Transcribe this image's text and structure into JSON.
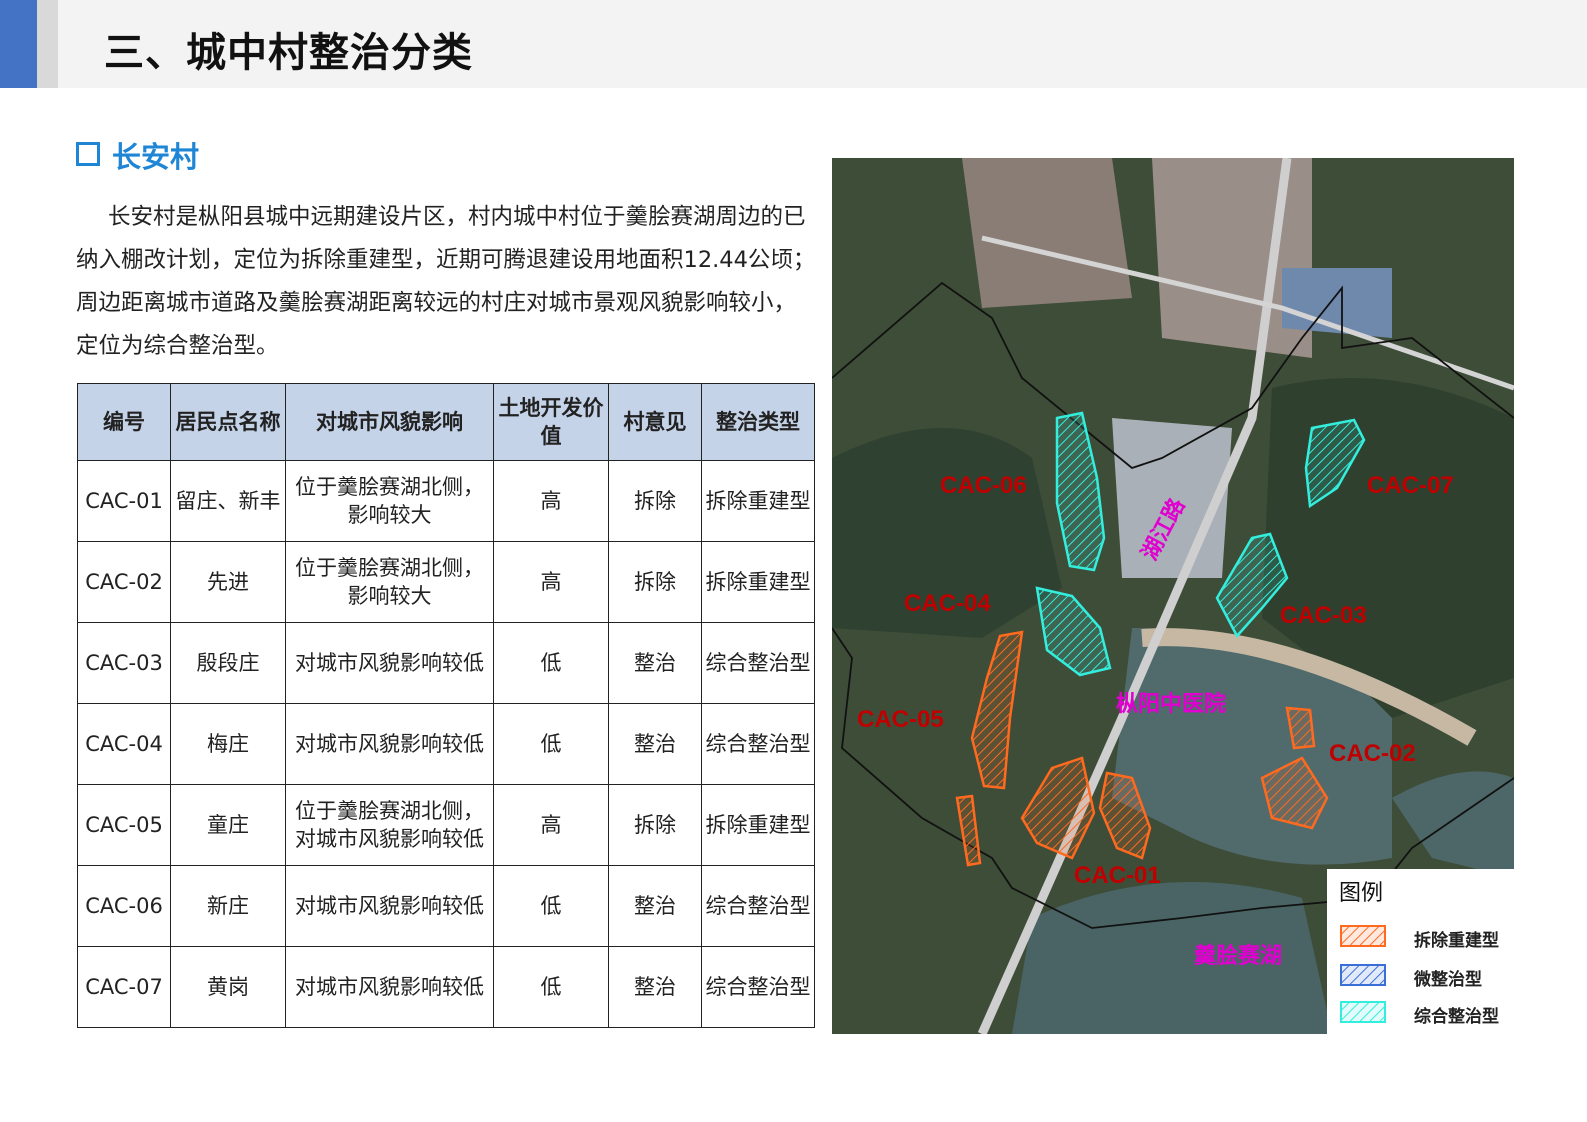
{
  "header": {
    "title": "三、城中村整治分类"
  },
  "section": {
    "title": "长安村"
  },
  "paragraph": "长安村是枞阳县城中远期建设片区，村内城中村位于羹脍赛湖周边的已纳入棚改计划，定位为拆除重建型，近期可腾退建设用地面积12.44公顷；周边距离城市道路及羹脍赛湖距离较远的村庄对城市景观风貌影响较小，定位为综合整治型。",
  "table": {
    "headers": [
      "编号",
      "居民点名称",
      "对城市风貌影响",
      "土地开发价值",
      "村意见",
      "整治类型"
    ],
    "rows": [
      [
        "CAC-01",
        "留庄、新丰",
        "位于羹脍赛湖北侧，影响较大",
        "高",
        "拆除",
        "拆除重建型"
      ],
      [
        "CAC-02",
        "先进",
        "位于羹脍赛湖北侧，影响较大",
        "高",
        "拆除",
        "拆除重建型"
      ],
      [
        "CAC-03",
        "殷段庄",
        "对城市风貌影响较低",
        "低",
        "整治",
        "综合整治型"
      ],
      [
        "CAC-04",
        "梅庄",
        "对城市风貌影响较低",
        "低",
        "整治",
        "综合整治型"
      ],
      [
        "CAC-05",
        "童庄",
        "位于羹脍赛湖北侧，对城市风貌影响较低",
        "高",
        "拆除",
        "拆除重建型"
      ],
      [
        "CAC-06",
        "新庄",
        "对城市风貌影响较低",
        "低",
        "整治",
        "综合整治型"
      ],
      [
        "CAC-07",
        "黄岗",
        "对城市风貌影响较低",
        "低",
        "整治",
        "综合整治型"
      ]
    ]
  },
  "map": {
    "labels": {
      "cac01": "CAC-01",
      "cac02": "CAC-02",
      "cac03": "CAC-03",
      "cac04": "CAC-04",
      "cac05": "CAC-05",
      "cac06": "CAC-06",
      "cac07": "CAC-07",
      "road": "湖江路",
      "hospital": "枞阳中医院",
      "lake": "羹脍赛湖"
    },
    "legend": {
      "title": "图例",
      "items": [
        "拆除重建型",
        "微整治型",
        "综合整治型"
      ]
    },
    "colors": {
      "demolish": "#ff6a1f",
      "micro": "#3a6fd8",
      "comprehensive": "#33eedd",
      "label_red": "#c00000",
      "label_magenta": "#e000d0"
    }
  }
}
